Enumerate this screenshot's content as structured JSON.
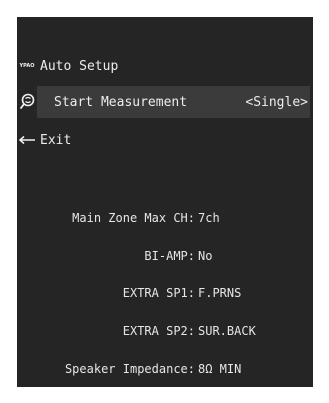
{
  "menu": {
    "title_icon": "ypao-logo-icon",
    "title_icon_text": "YPAO",
    "title": "Auto Setup",
    "start_icon": "microphone-icon",
    "start_label": "Start Measurement",
    "start_value": "<Single>",
    "exit_icon": "return-arrow-icon",
    "exit_label": "Exit"
  },
  "info": [
    {
      "label": "Main Zone Max CH:",
      "value": "7ch"
    },
    {
      "label": "BI-AMP:",
      "value": "No"
    },
    {
      "label": "EXTRA SP1:",
      "value": "F.PRNS"
    },
    {
      "label": "EXTRA SP2:",
      "value": "SUR.BACK"
    },
    {
      "label": "Speaker Impedance:",
      "value": "8Ω MIN"
    }
  ],
  "colors": {
    "screen_bg": "#252525",
    "highlight_bg": "#3b3b3b",
    "text": "#ececec"
  }
}
